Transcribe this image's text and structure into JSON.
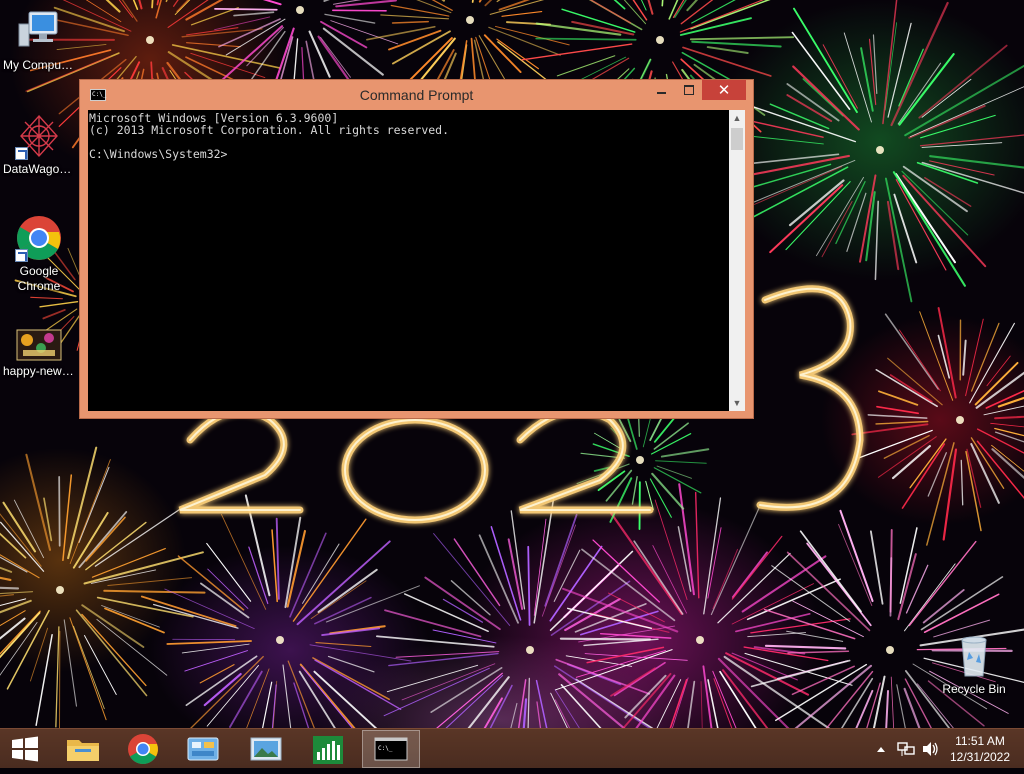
{
  "desktop": {
    "icons": [
      {
        "label": "My Computer",
        "icon": "computer-icon"
      },
      {
        "label": "DataWagon...",
        "icon": "datawagon-icon"
      },
      {
        "label": "Google Chrome",
        "icon": "chrome-icon"
      },
      {
        "label": "happy-new-...",
        "icon": "image-file-icon"
      },
      {
        "label": "Recycle Bin",
        "icon": "recycle-bin-icon"
      }
    ],
    "wallpaper_text": "2023"
  },
  "cmd_window": {
    "title": "Command Prompt",
    "close_glyph": "✕",
    "lines": [
      "Microsoft Windows [Version 6.3.9600]",
      "(c) 2013 Microsoft Corporation. All rights reserved.",
      "",
      "C:\\Windows\\System32>"
    ],
    "icon_text": "C:\\_"
  },
  "taskbar": {
    "buttons": [
      {
        "name": "start-button",
        "icon": "windows-logo-icon"
      },
      {
        "name": "file-explorer",
        "icon": "folder-icon"
      },
      {
        "name": "google-chrome",
        "icon": "chrome-icon"
      },
      {
        "name": "control-panel",
        "icon": "control-panel-icon"
      },
      {
        "name": "photo-viewer",
        "icon": "photo-icon"
      },
      {
        "name": "task-manager",
        "icon": "chart-icon"
      },
      {
        "name": "command-prompt",
        "icon": "cmd-icon",
        "active": true
      }
    ],
    "tray": {
      "time": "11:51 AM",
      "date": "12/31/2022",
      "icons": [
        "show-hidden-icons",
        "network-icon",
        "volume-icon"
      ]
    }
  },
  "colors": {
    "window_frame": "#e8956f",
    "close_button": "#c7423a",
    "taskbar": "#4e2f22"
  }
}
